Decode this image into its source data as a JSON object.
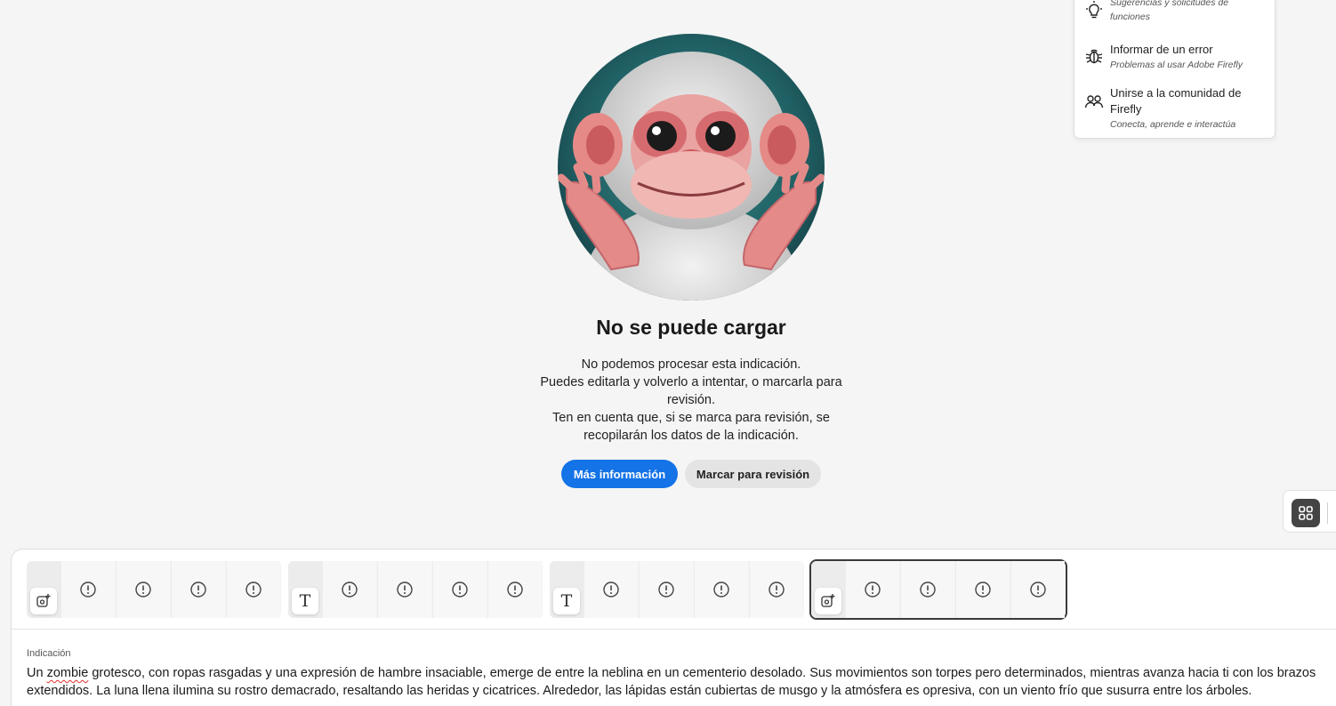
{
  "help_menu": {
    "items": [
      {
        "icon": "lightbulb-icon",
        "title": "",
        "subtitle": "Sugerencias y solicitudes de funciones"
      },
      {
        "icon": "bug-icon",
        "title": "Informar de un error",
        "subtitle": "Problemas al usar Adobe Firefly"
      },
      {
        "icon": "community-icon",
        "title": "Unirse a la comunidad de Firefly",
        "subtitle": "Conecta, aprende e interactúa"
      }
    ]
  },
  "error": {
    "title": "No se puede cargar",
    "lines": [
      "No podemos procesar esta indicación.",
      "Puedes editarla y volverlo a intentar, o marcarla para revisión.",
      "Ten en cuenta que, si se marca para revisión, se recopilarán los datos de la indicación."
    ],
    "primary_button": "Más información",
    "secondary_button": "Marcar para revisión"
  },
  "generations": [
    {
      "type": "image-generate-icon",
      "badge": "",
      "thumbs": 4,
      "selected": false
    },
    {
      "type": "text-icon",
      "badge": "T",
      "thumbs": 4,
      "selected": false
    },
    {
      "type": "text-icon",
      "badge": "T",
      "thumbs": 4,
      "selected": false
    },
    {
      "type": "image-generate-icon",
      "badge": "",
      "thumbs": 4,
      "selected": true
    }
  ],
  "prompt": {
    "label": "Indicación",
    "text_before": "Un ",
    "misspelled": "zombie",
    "text_after": " grotesco, con ropas rasgadas y una expresión de hambre insaciable, emerge de entre la neblina en un cementerio desolado. Sus movimientos son torpes pero determinados, mientras avanza hacia ti con los brazos extendidos. La luna llena ilumina su rostro demacrado, resaltando las heridas y cicatrices. Alrededor, las lápidas están cubiertas de musgo y la atmósfera es opresiva, con un viento frío que susurra entre los árboles."
  },
  "colors": {
    "accent": "#1473e6",
    "background": "#f5f5f5"
  }
}
